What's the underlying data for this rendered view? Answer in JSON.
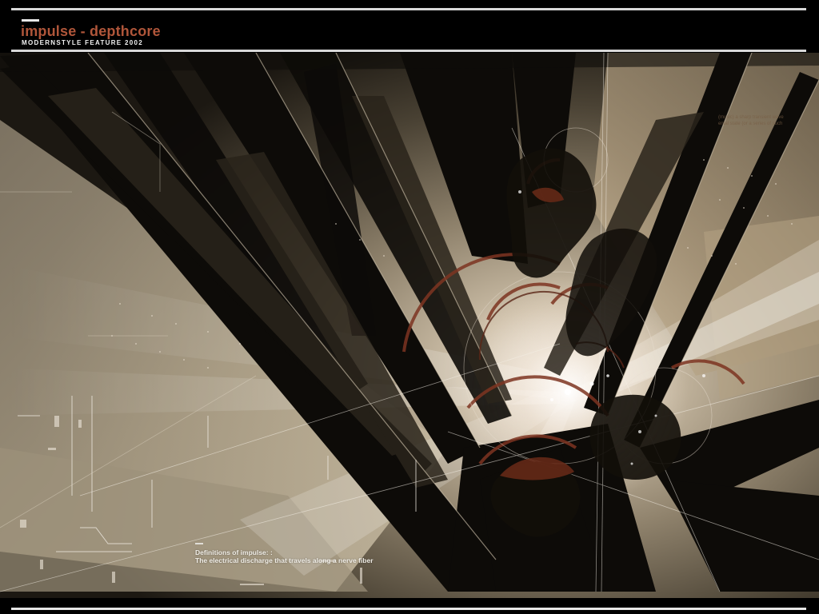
{
  "header": {
    "title": "impulse - depthcore",
    "subtitle": "MODERNSTYLE FEATURE 2002"
  },
  "caption": {
    "heading": "Definitions of impulse: :",
    "text": "The electrical discharge that travels along a nerve fiber"
  },
  "faint_text": {
    "line1": "(music) a sharp transient wave",
    "line2": "ental state (or a series of such"
  },
  "colors": {
    "title": "#b0563a",
    "background": "#000000",
    "rules": "#d8d8d8",
    "warm_light": "#c8b69a",
    "rust_accent": "#8a3a22"
  }
}
